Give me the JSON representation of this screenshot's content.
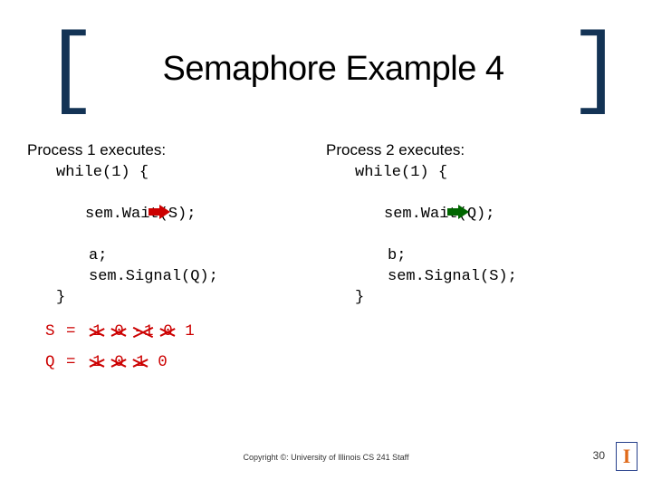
{
  "title": "Semaphore Example 4",
  "process1": {
    "heading": "Process 1 executes:",
    "code": {
      "l1": "while(1) {",
      "l2": "sem.Wait(S);",
      "l3": "a;",
      "l4": "sem.Signal(Q);",
      "l5": "}"
    }
  },
  "process2": {
    "heading": "Process 2 executes:",
    "code": {
      "l1": "while(1) {",
      "l2": "sem.Wait(Q);",
      "l3": "b;",
      "l4": "sem.Signal(S);",
      "l5": "}"
    }
  },
  "s_label": "S = ",
  "q_label": "Q = ",
  "s_values": {
    "v0": "1",
    "v1": "0",
    "v2": "-1",
    "v3": "0",
    "v4": "1"
  },
  "q_values": {
    "v0": "1",
    "v1": "0",
    "v2": "1",
    "v3": "0"
  },
  "footer": "Copyright ©: University of Illinois CS 241 Staff",
  "page": "30",
  "logo": "I"
}
